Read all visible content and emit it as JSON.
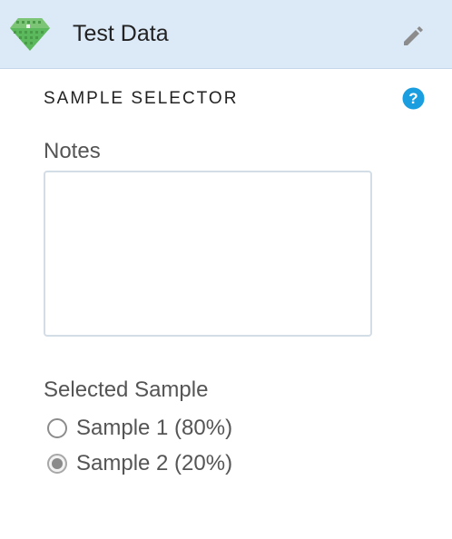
{
  "header": {
    "title": "Test Data",
    "icon": "gem-icon",
    "edit_icon": "pencil-icon",
    "background": "#dce9f7"
  },
  "section": {
    "title": "SAMPLE SELECTOR",
    "help_icon": "help-icon",
    "help_symbol": "?",
    "accent": "#1a9ee0"
  },
  "notes": {
    "label": "Notes",
    "value": "",
    "placeholder": ""
  },
  "sample_selector": {
    "label": "Selected Sample",
    "options": [
      {
        "label": "Sample 1 (80%)",
        "checked": false
      },
      {
        "label": "Sample 2 (20%)",
        "checked": true
      }
    ]
  }
}
